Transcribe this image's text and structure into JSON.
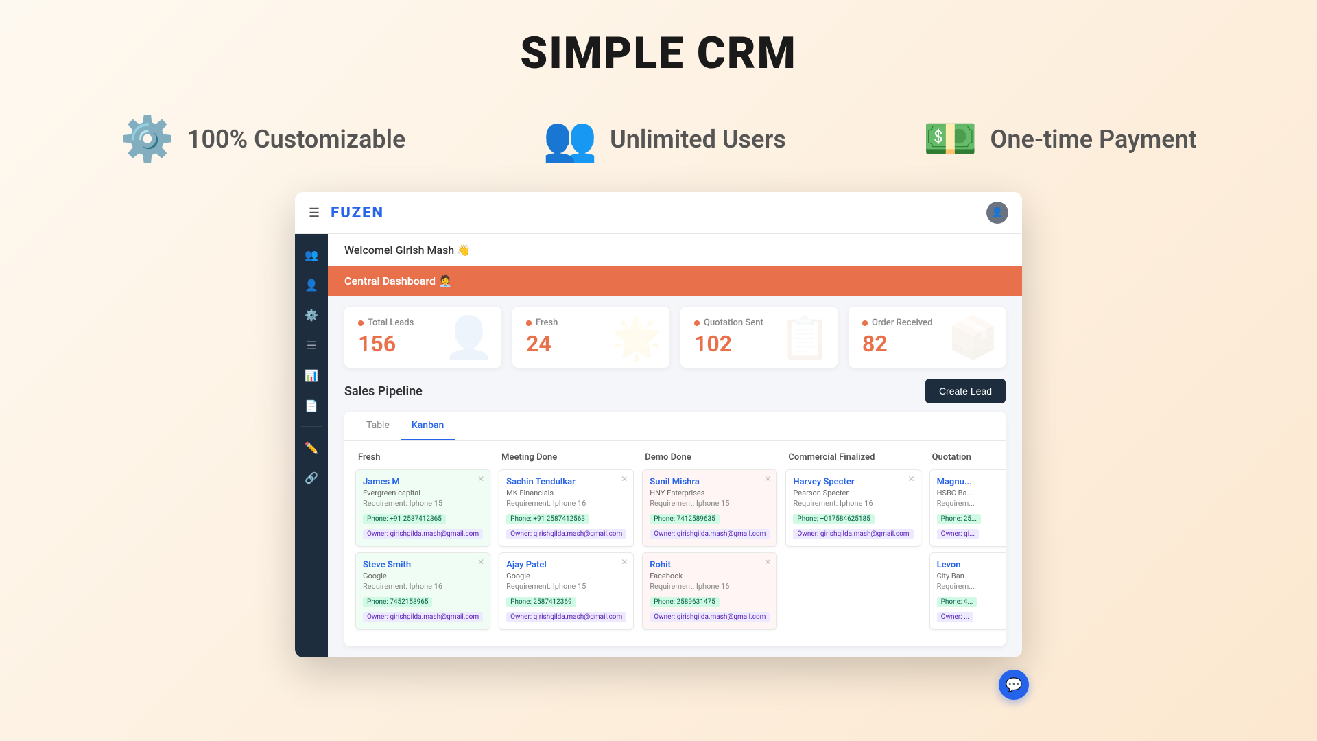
{
  "page": {
    "title": "SIMPLE CRM"
  },
  "features": [
    {
      "id": "customizable",
      "icon": "⚙️",
      "text": "100% Customizable"
    },
    {
      "id": "users",
      "icon": "👥",
      "text": "Unlimited Users"
    },
    {
      "id": "payment",
      "icon": "💵",
      "text": "One-time Payment"
    }
  ],
  "app": {
    "brand": "FUZEN",
    "welcome": "Welcome! Girish Mash 👋",
    "dashboard_title": "Central Dashboard 🧑‍💼"
  },
  "stats": [
    {
      "label": "Total Leads",
      "value": "156"
    },
    {
      "label": "Fresh",
      "value": "24"
    },
    {
      "label": "Quotation Sent",
      "value": "102"
    },
    {
      "label": "Order Received",
      "value": "82"
    }
  ],
  "pipeline": {
    "title": "Sales Pipeline",
    "create_lead_label": "Create Lead"
  },
  "tabs": [
    {
      "label": "Table",
      "active": false
    },
    {
      "label": "Kanban",
      "active": true
    }
  ],
  "kanban_columns": [
    {
      "title": "Fresh",
      "class": "fresh-col",
      "cards": [
        {
          "name": "James M",
          "company": "Evergreen capital",
          "req": "Requirement: Iphone 15",
          "phone": "Phone: +91 2587412365",
          "owner": "Owner: girishgilda.mash@gmail.com"
        },
        {
          "name": "Steve Smith",
          "company": "Google",
          "req": "Requirement: Iphone 16",
          "phone": "Phone: 7452158965",
          "owner": "Owner: girishgilda.mash@gmail.com"
        }
      ]
    },
    {
      "title": "Meeting Done",
      "class": "",
      "cards": [
        {
          "name": "Sachin Tendulkar",
          "company": "MK Financials",
          "req": "Requirement: Iphone 16",
          "phone": "Phone: +91 2587412563",
          "owner": "Owner: girishgilda.mash@gmail.com"
        },
        {
          "name": "Ajay Patel",
          "company": "Google",
          "req": "Requirement: Iphone 15",
          "phone": "Phone: 2587412369",
          "owner": "Owner: girishgilda.mash@gmail.com"
        }
      ]
    },
    {
      "title": "Demo Done",
      "class": "demo-col",
      "cards": [
        {
          "name": "Sunil Mishra",
          "company": "HNY Enterprises",
          "req": "Requirement: Iphone 15",
          "phone": "Phone: 7412589635",
          "owner": "Owner: girishgilda.mash@gmail.com"
        },
        {
          "name": "Rohit",
          "company": "Facebook",
          "req": "Requirement: Iphone 16",
          "phone": "Phone: 2589631475",
          "owner": "Owner: girishgilda.mash@gmail.com"
        }
      ]
    },
    {
      "title": "Commercial Finalized",
      "class": "",
      "cards": [
        {
          "name": "Harvey Specter",
          "company": "Pearson Specter",
          "req": "Requirement: Iphone 16",
          "phone": "Phone: +017584625185",
          "owner": "Owner: girishgilda.mash@gmail.com"
        }
      ]
    },
    {
      "title": "Quotation",
      "class": "",
      "cards": [
        {
          "name": "Magnu...",
          "company": "HSBC Ba...",
          "req": "Requirem...",
          "phone": "Phone: 25...",
          "owner": "Owner: gi..."
        },
        {
          "name": "Levon",
          "company": "City Ban...",
          "req": "Requirem...",
          "phone": "Phone: 4...",
          "owner": "Owner: ..."
        }
      ]
    }
  ],
  "sidebar_icons": [
    {
      "id": "people-group",
      "symbol": "👥"
    },
    {
      "id": "person-plus",
      "symbol": "👤"
    },
    {
      "id": "settings",
      "symbol": "⚙️"
    },
    {
      "id": "list",
      "symbol": "☰"
    },
    {
      "id": "chart",
      "symbol": "📊"
    },
    {
      "id": "document",
      "symbol": "📄"
    },
    {
      "id": "edit",
      "symbol": "✏️"
    },
    {
      "id": "share",
      "symbol": "🔗"
    }
  ]
}
